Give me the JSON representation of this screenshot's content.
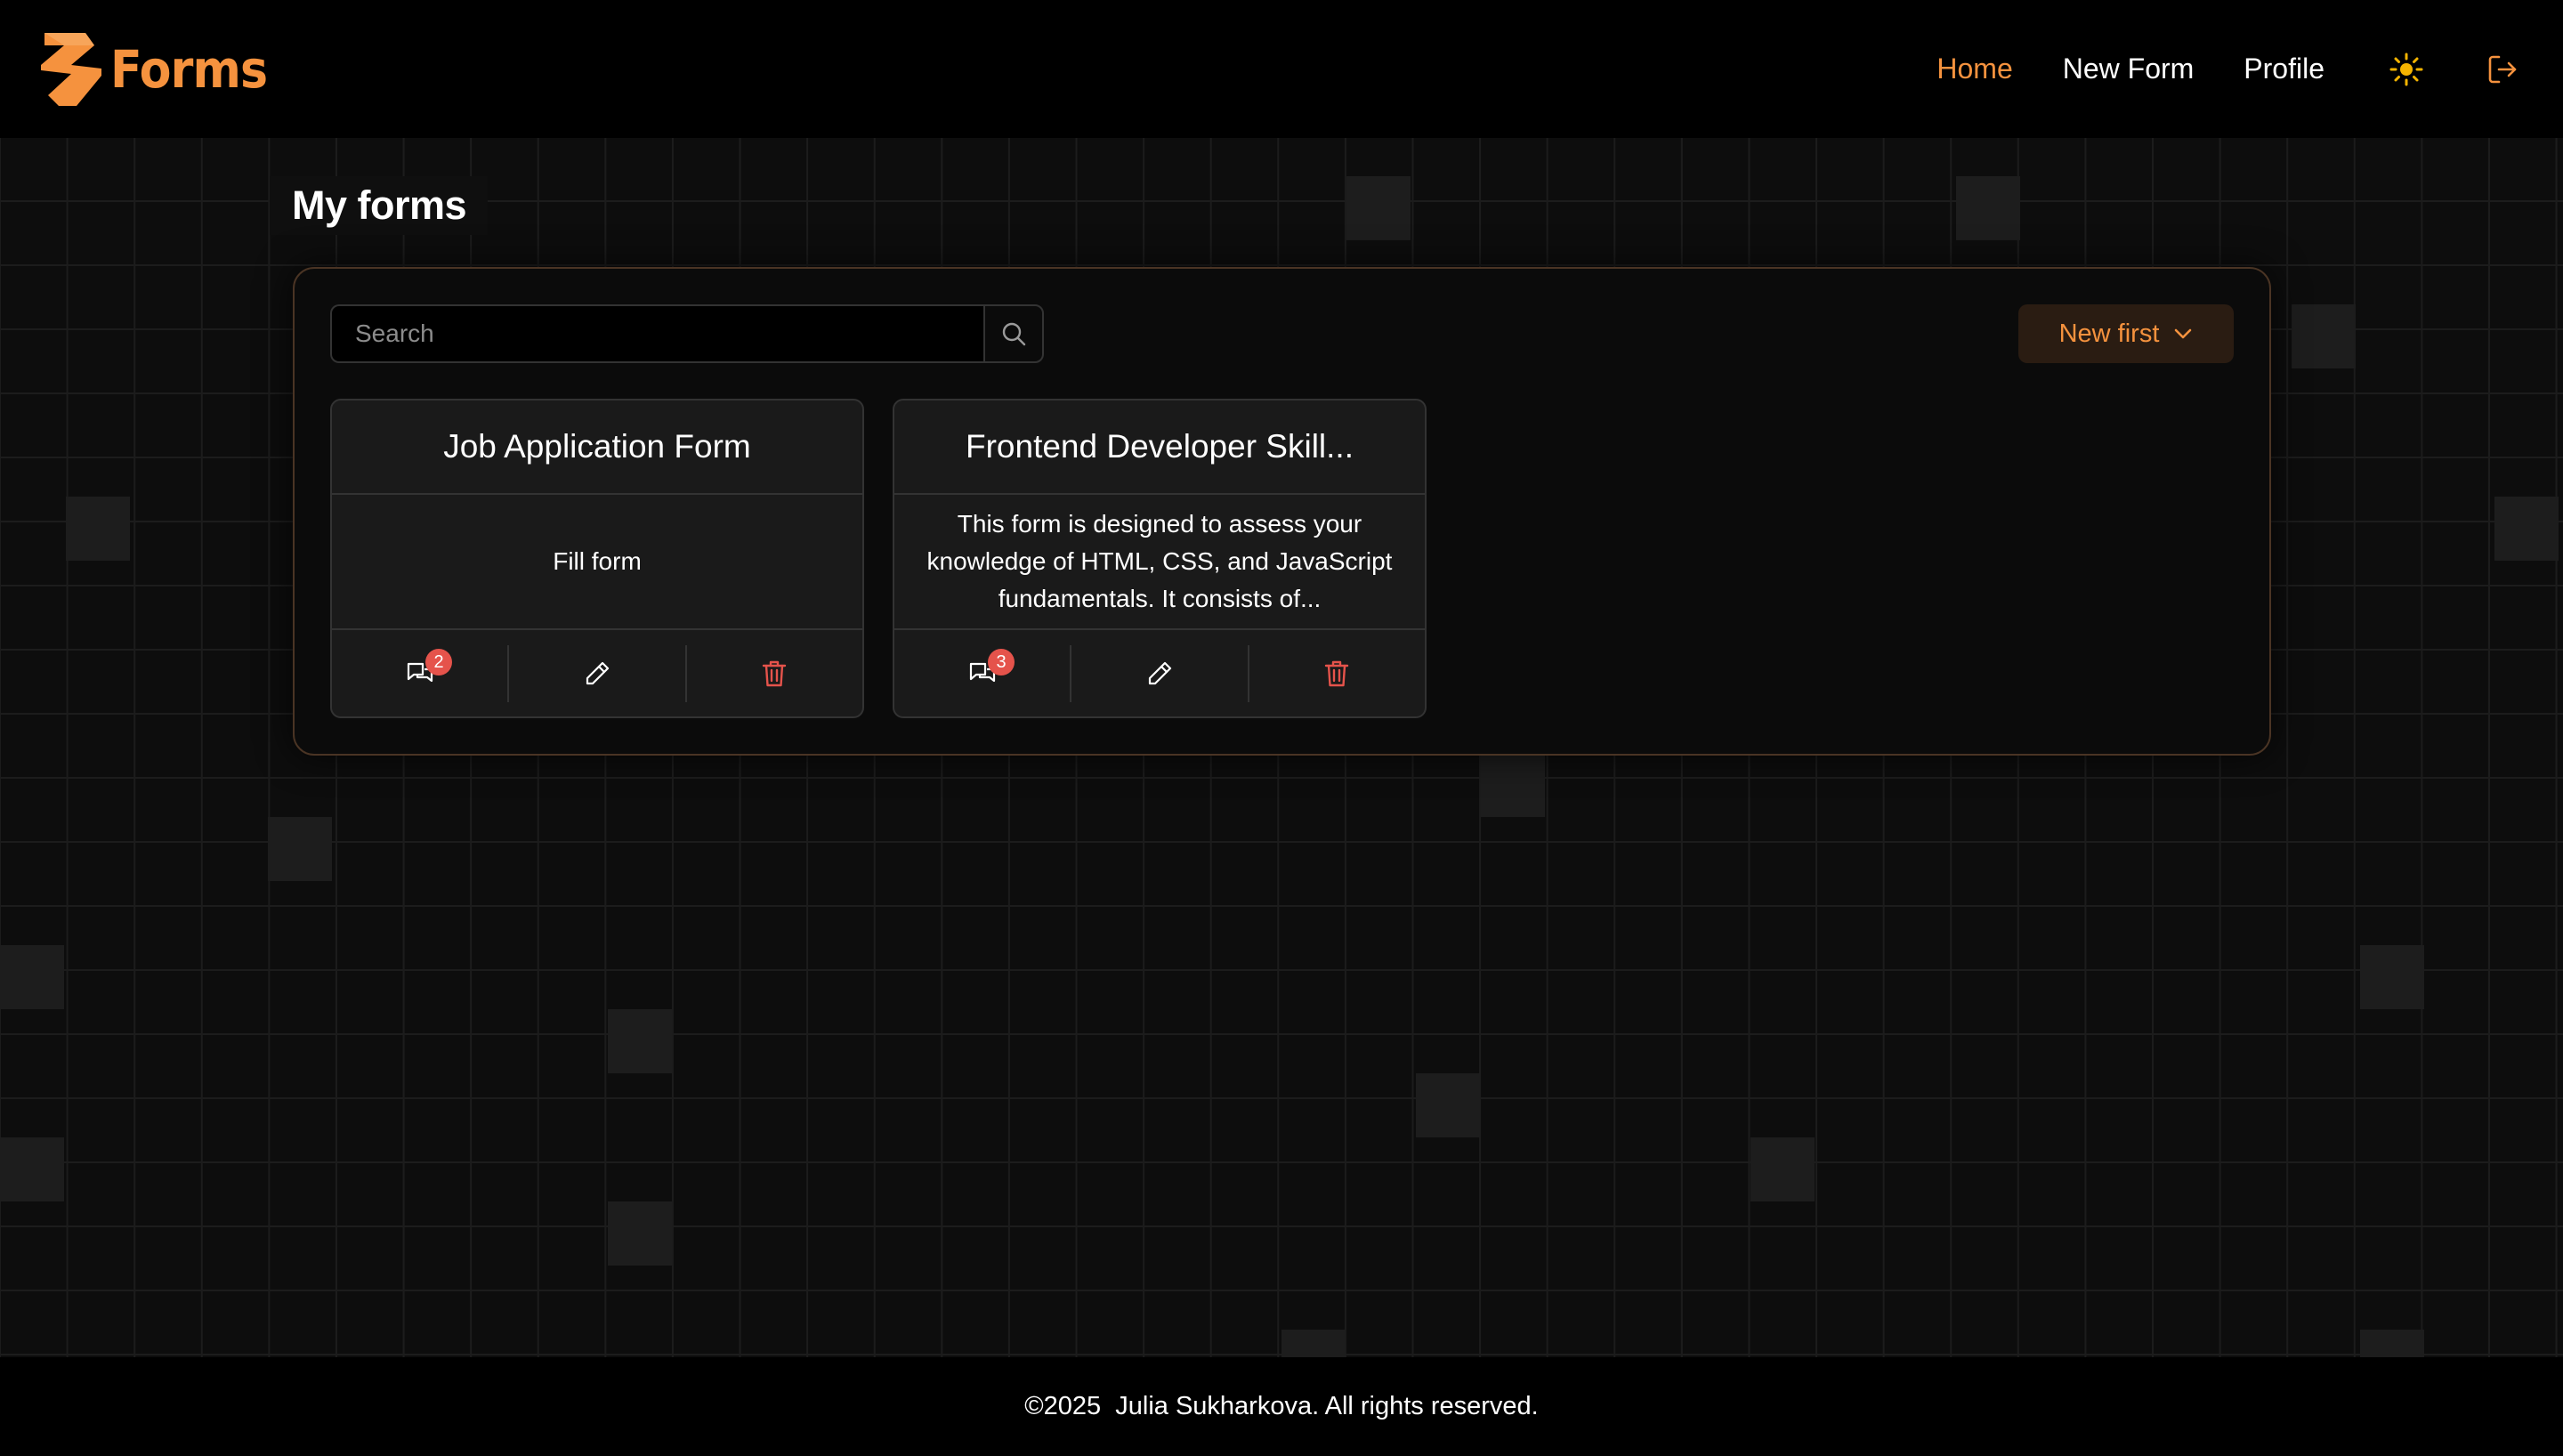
{
  "brand": {
    "name": "Forms",
    "accent": "#f5923e"
  },
  "nav": {
    "items": [
      {
        "label": "Home",
        "active": true
      },
      {
        "label": "New Form",
        "active": false
      },
      {
        "label": "Profile",
        "active": false
      }
    ],
    "theme_icon": "sun-icon",
    "logout_icon": "logout-icon"
  },
  "main": {
    "title": "My forms",
    "search": {
      "placeholder": "Search",
      "value": ""
    },
    "sort": {
      "label": "New first"
    },
    "forms": [
      {
        "title": "Job Application Form",
        "description": "Fill form",
        "responses": "2"
      },
      {
        "title": "Frontend Developer Skill...",
        "description": "This form is designed to assess your knowledge of HTML, CSS, and JavaScript fundamentals. It consists of...",
        "responses": "3"
      }
    ]
  },
  "footer": {
    "text": "©2025  Julia Sukharkova. All rights reserved."
  },
  "colors": {
    "danger": "#e5534b",
    "background": "#0d0d0d",
    "header": "#000000"
  }
}
